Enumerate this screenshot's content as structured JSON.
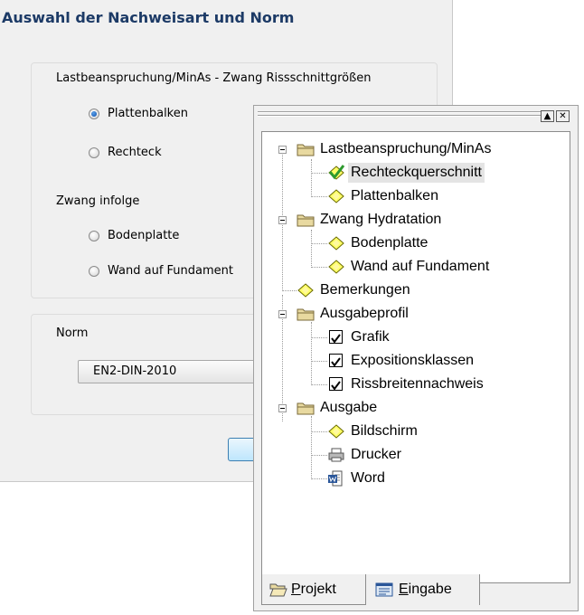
{
  "dialog": {
    "title": "Auswahl der Nachweisart und Norm",
    "group1_heading": "Lastbeanspruchung/MinAs - Zwang Rissschnittgrößen",
    "options_a": [
      "Plattenbalken",
      "Rechteck"
    ],
    "selected_option_a": "Plattenbalken",
    "zwang_heading": "Zwang infolge",
    "options_b": [
      "Bodenplatte",
      "Wand auf Fundament"
    ],
    "norm_label": "Norm",
    "norm_value": "EN2-DIN-2010"
  },
  "panel": {
    "scroll_up_glyph": "▲",
    "close_glyph": "✕",
    "tree": [
      {
        "label": "Lastbeanspruchung/MinAs",
        "icon": "folder-icon",
        "level": 0
      },
      {
        "label": "Rechteckquerschnitt",
        "icon": "checked-diamond-icon",
        "level": 1,
        "selected": true
      },
      {
        "label": "Plattenbalken",
        "icon": "diamond-icon",
        "level": 1
      },
      {
        "label": "Zwang Hydratation",
        "icon": "folder-icon",
        "level": 0
      },
      {
        "label": "Bodenplatte",
        "icon": "diamond-icon",
        "level": 1
      },
      {
        "label": "Wand auf Fundament",
        "icon": "diamond-icon",
        "level": 1
      },
      {
        "label": "Bemerkungen",
        "icon": "diamond-icon",
        "level": 0
      },
      {
        "label": "Ausgabeprofil",
        "icon": "folder-icon",
        "level": 0
      },
      {
        "label": "Grafik",
        "icon": "checkbox-checked-icon",
        "level": 1
      },
      {
        "label": "Expositionsklassen",
        "icon": "checkbox-checked-icon",
        "level": 1
      },
      {
        "label": "Rissbreitennachweis",
        "icon": "checkbox-checked-icon",
        "level": 1
      },
      {
        "label": "Ausgabe",
        "icon": "folder-icon",
        "level": 0
      },
      {
        "label": "Bildschirm",
        "icon": "diamond-icon",
        "level": 1
      },
      {
        "label": "Drucker",
        "icon": "printer-icon",
        "level": 1
      },
      {
        "label": "Word",
        "icon": "word-icon",
        "level": 1
      }
    ],
    "tabs": [
      {
        "label": "Projekt",
        "accesskey": "P",
        "icon": "open-folder-icon",
        "active": true
      },
      {
        "label": "Eingabe",
        "accesskey": "E",
        "icon": "form-icon",
        "active": false
      }
    ]
  },
  "colors": {
    "title_text": "#1c3a66",
    "dialog_bg": "#f0f0f0",
    "diamond_fill": "#ffff66",
    "folder_fill": "#e8d9a0",
    "check_green": "#2e9a2e",
    "selection_bg": "#e4e4e4"
  }
}
